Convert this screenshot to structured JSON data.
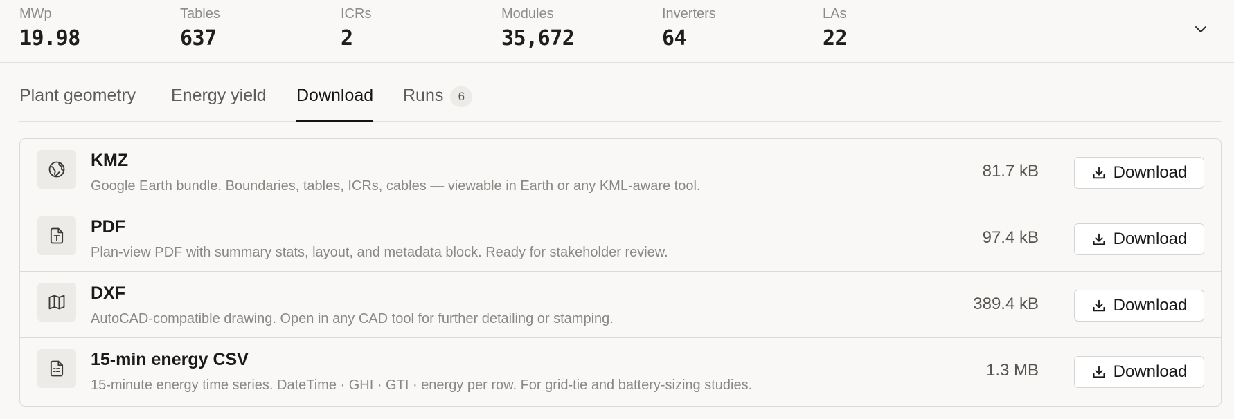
{
  "stats": [
    {
      "label": "MWp",
      "value": "19.98"
    },
    {
      "label": "Tables",
      "value": "637"
    },
    {
      "label": "ICRs",
      "value": "2"
    },
    {
      "label": "Modules",
      "value": "35,672"
    },
    {
      "label": "Inverters",
      "value": "64"
    },
    {
      "label": "LAs",
      "value": "22"
    }
  ],
  "tabs": [
    {
      "label": "Plant geometry"
    },
    {
      "label": "Energy yield"
    },
    {
      "label": "Download",
      "active": true
    },
    {
      "label": "Runs",
      "badge": "6"
    }
  ],
  "downloads": [
    {
      "icon": "globe-icon",
      "title": "KMZ",
      "description": "Google Earth bundle. Boundaries, tables, ICRs, cables — viewable in Earth or any KML-aware tool.",
      "size": "81.7 kB",
      "button": "Download"
    },
    {
      "icon": "pdf-file-icon",
      "title": "PDF",
      "description": "Plan-view PDF with summary stats, layout, and metadata block. Ready for stakeholder review.",
      "size": "97.4 kB",
      "button": "Download"
    },
    {
      "icon": "map-icon",
      "title": "DXF",
      "description": "AutoCAD-compatible drawing. Open in any CAD tool for further detailing or stamping.",
      "size": "389.4 kB",
      "button": "Download"
    },
    {
      "icon": "spreadsheet-icon",
      "title": "15-min energy CSV",
      "description": "15-minute energy time series. DateTime · GHI · GTI · energy per row. For grid-tie and battery-sizing studies.",
      "size": "1.3 MB",
      "button": "Download"
    }
  ]
}
